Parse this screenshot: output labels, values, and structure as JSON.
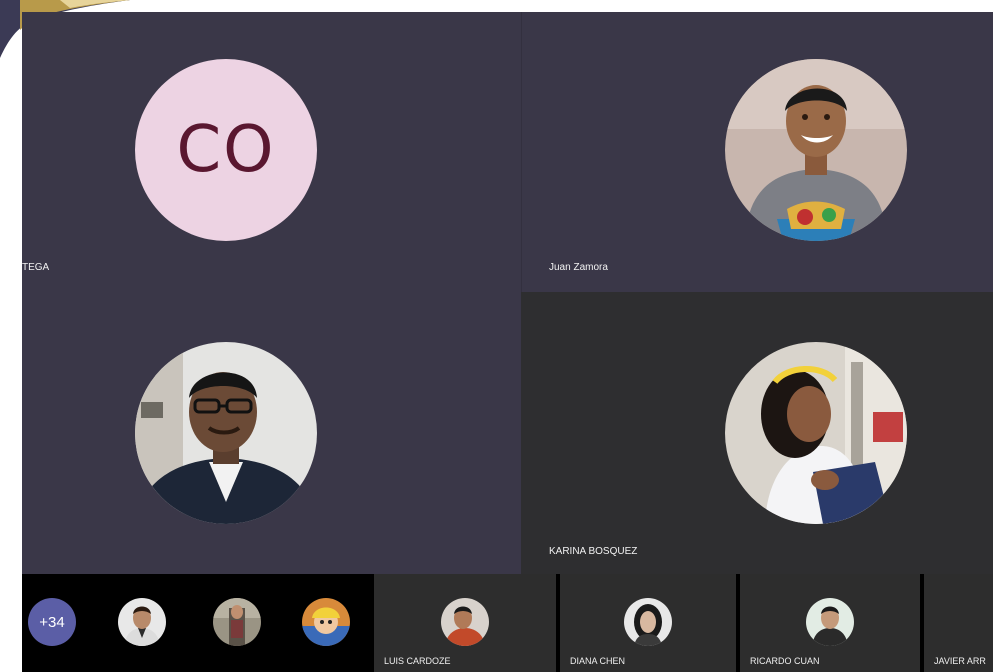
{
  "tiles": [
    {
      "id": "tile-ortega",
      "name": "TEGA",
      "avatar_type": "initials",
      "initials": "CO",
      "initials_bg": "#edd3e3",
      "initials_color": "#5a1730"
    },
    {
      "id": "tile-juan",
      "name": "Juan Zamora",
      "avatar_type": "photo"
    },
    {
      "id": "tile-speaker",
      "name": "",
      "avatar_type": "photo"
    },
    {
      "id": "tile-karina",
      "name": "KARINA BOSQUEZ",
      "avatar_type": "photo"
    }
  ],
  "strip": {
    "overflow_count": "+34",
    "participants": [
      {
        "name": "LUIS CARDOZE"
      },
      {
        "name": "DIANA CHEN"
      },
      {
        "name": "RICARDO CUAN"
      },
      {
        "name": "JAVIER ARR"
      }
    ]
  },
  "colors": {
    "tile_bg": "#3a3748",
    "active_tile_bg": "#2e2e30",
    "strip_cell_bg": "#2d2d2d",
    "overflow_badge": "#5b5ea6"
  },
  "icons": [
    "person-photo-icon",
    "corner-flourish-icon"
  ]
}
